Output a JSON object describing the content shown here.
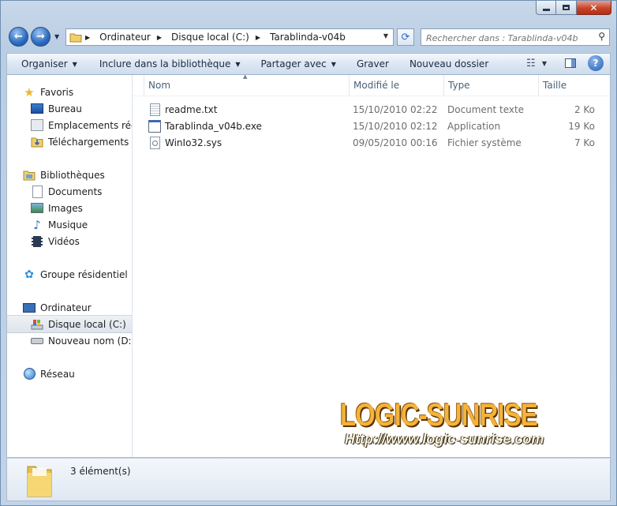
{
  "window": {
    "caption_buttons": [
      "minimize-icon",
      "maximize-icon",
      "close-icon"
    ]
  },
  "address": {
    "crumbs": [
      "Ordinateur",
      "Disque local (C:)",
      "Tarablinda-v04b"
    ],
    "search_placeholder": "Rechercher dans : Tarablinda-v04b"
  },
  "toolbar": {
    "organize": "Organiser",
    "include_library": "Inclure dans la bibliothèque",
    "share_with": "Partager avec",
    "burn": "Graver",
    "new_folder": "Nouveau dossier"
  },
  "nav": {
    "favorites": "Favoris",
    "desktop": "Bureau",
    "recent_places": "Emplacements récen",
    "downloads": "Téléchargements",
    "libraries": "Bibliothèques",
    "documents": "Documents",
    "images": "Images",
    "music": "Musique",
    "videos": "Vidéos",
    "homegroup": "Groupe résidentiel",
    "computer": "Ordinateur",
    "local_disk_c": "Disque local (C:)",
    "new_volume_d": "Nouveau nom (D:)",
    "network": "Réseau"
  },
  "columns": {
    "name": "Nom",
    "modified": "Modifié le",
    "type": "Type",
    "size": "Taille"
  },
  "files": [
    {
      "name": "readme.txt",
      "modified": "15/10/2010 02:22",
      "type": "Document texte",
      "size": "2 Ko",
      "icon": "text-file-icon"
    },
    {
      "name": "Tarablinda_v04b.exe",
      "modified": "15/10/2010 02:12",
      "type": "Application",
      "size": "19 Ko",
      "icon": "application-icon"
    },
    {
      "name": "WinIo32.sys",
      "modified": "09/05/2010 00:16",
      "type": "Fichier système",
      "size": "7 Ko",
      "icon": "system-file-icon"
    }
  ],
  "details": {
    "item_count": "3 élément(s)"
  },
  "watermark": {
    "title": "LOGIC-SUNRISE",
    "url": "Http://www.logic-sunrise.com"
  }
}
